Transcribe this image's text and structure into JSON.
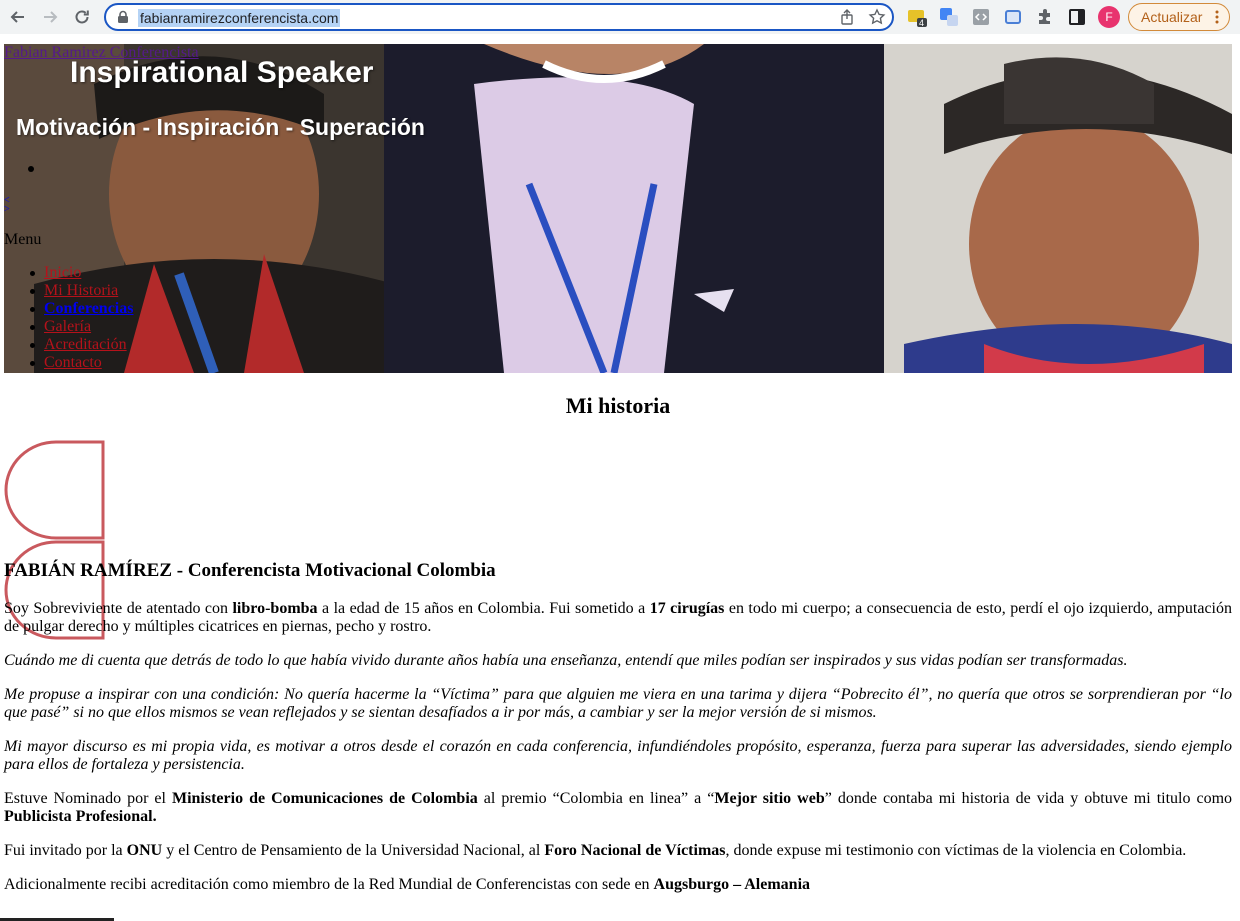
{
  "browser": {
    "url": "fabianramirezconferencista.com",
    "extension_badge": "4",
    "profile_initial": "F",
    "update_label": "Actualizar"
  },
  "hero": {
    "site_name": "Fabian Ramirez Conferencista",
    "title": "Inspirational Speaker",
    "subtitle": "Motivación - Inspiración - Superación",
    "prev": "<",
    "next": ">"
  },
  "menu": {
    "label": "Menu",
    "items": [
      {
        "label": "Inicio"
      },
      {
        "label": "Mi Historia"
      },
      {
        "label": "Conferencias"
      },
      {
        "label": "Galería"
      },
      {
        "label": "Acreditación"
      },
      {
        "label": "Contacto"
      }
    ]
  },
  "content": {
    "page_title": "Mi historia",
    "heading": "FABIÁN RAMÍREZ - Conferencista Motivacional Colombia",
    "p1": {
      "a": "Soy Sobreviviente de atentado con ",
      "b": "libro-bomba",
      "c": " a la edad de 15 años en Colombia. Fui sometido a ",
      "d": "17 cirugías",
      "e": " en todo mi cuerpo; a consecuencia de esto, perdí el ojo izquierdo, amputación de pulgar derecho y múltiples cicatrices en piernas, pecho y rostro."
    },
    "p2": "Cuándo me di cuenta que detrás de todo lo que había vivido durante años había una enseñanza, entendí que miles podían ser inspirados y sus vidas podían ser transformadas.",
    "p3": "Me propuse a inspirar con una condición: No quería hacerme la “Víctima” para que alguien me viera en una tarima y dijera “Pobrecito él”, no quería que otros se sorprendieran por “lo que pasé” si no que ellos mismos se vean reflejados y se sientan desafíados a ir por más, a cambiar y ser la mejor versión de si mismos.",
    "p4": "Mi mayor discurso es mi propia vida, es motivar a otros desde el corazón en cada conferencia, infundiéndoles propósito, esperanza, fuerza para superar las adversidades, siendo ejemplo para ellos de fortaleza y persistencia.",
    "p5": {
      "a": "Estuve Nominado por el ",
      "b": "Ministerio de Comunicaciones de Colombia",
      "c": " al premio “Colombia en linea” a “",
      "d": "Mejor sitio web",
      "e": "” donde contaba mi historia de vida y obtuve mi titulo como ",
      "f": "Publicista Profesional."
    },
    "p6": {
      "a": "Fui invitado por la ",
      "b": "ONU",
      "c": " y el Centro de Pensamiento de la Universidad Nacional, al ",
      "d": "Foro Nacional de Víctimas",
      "e": ", donde expuse mi testimonio con víctimas de la violencia en Colombia."
    },
    "p7": {
      "a": "Adicionalmente recibi acreditación como miembro de la Red Mundial de Conferencistas con sede en ",
      "b": "Augsburgo – Alemania"
    }
  },
  "colors": {
    "accent_outline": "#c9595e",
    "menu_link": "#b5121b",
    "active_link": "#0000ee",
    "omnibox_border": "#1a56c4"
  }
}
